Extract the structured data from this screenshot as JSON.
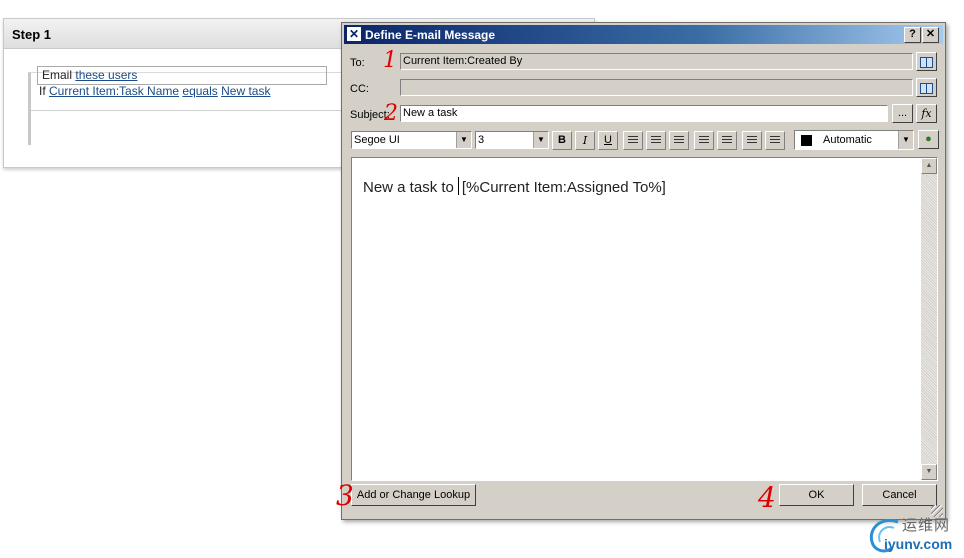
{
  "workflow": {
    "step_title": "Step 1",
    "condition": {
      "if_word": "If",
      "field": "Current Item:Task Name",
      "operator": "equals",
      "value": "New task"
    },
    "action": {
      "verb": "Email",
      "target": "these users"
    }
  },
  "dialog": {
    "title": "Define E-mail Message",
    "help_btn": "?",
    "close_btn": "✕",
    "to_label": "To:",
    "to_value": "Current Item:Created By",
    "cc_label": "CC:",
    "cc_value": "",
    "subject_label": "Subject:",
    "subject_value": "New a task",
    "ellipsis_btn": "...",
    "fx_btn": "fx",
    "toolbar": {
      "font_name": "Segoe UI",
      "font_size": "3",
      "bold": "B",
      "italic": "I",
      "underline": "U",
      "color_label": "Automatic",
      "color_value": "#000000"
    },
    "body_text": "New a task to",
    "body_lookup": "[%Current Item:Assigned To%]",
    "add_lookup_btn": "Add or Change Lookup",
    "ok_btn": "OK",
    "cancel_btn": "Cancel"
  },
  "annotations": [
    "1",
    "2",
    "3",
    "4"
  ],
  "watermark": {
    "chinese": "运维网",
    "url": "iyunv.com"
  }
}
